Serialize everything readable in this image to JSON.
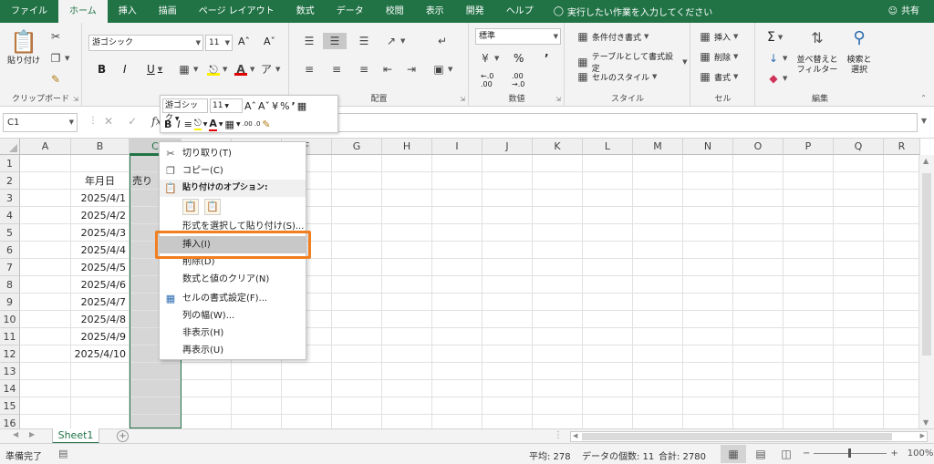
{
  "menubar": {
    "tabs": [
      "ファイル",
      "ホーム",
      "挿入",
      "描画",
      "ページ レイアウト",
      "数式",
      "データ",
      "校閲",
      "表示",
      "開発",
      "ヘルプ"
    ],
    "active_tab": "ホーム",
    "tellme": "実行したい作業を入力してください",
    "share": "共有"
  },
  "ribbon": {
    "clipboard": {
      "label": "クリップボード",
      "paste": "貼り付け"
    },
    "font": {
      "label": "フォント",
      "name": "游ゴシック",
      "size": "11"
    },
    "alignment": {
      "label": "配置"
    },
    "number": {
      "label": "数値",
      "format": "標準"
    },
    "styles": {
      "label": "スタイル",
      "conditional": "条件付き書式",
      "table": "テーブルとして書式設定",
      "cellstyle": "セルのスタイル"
    },
    "cells": {
      "label": "セル",
      "insert": "挿入",
      "delete": "削除",
      "format": "書式"
    },
    "editing": {
      "label": "編集",
      "sort": "並べ替えと",
      "sort2": "フィルター",
      "find": "検索と",
      "find2": "選択"
    }
  },
  "formula_bar": {
    "name_box": "C1",
    "value": ""
  },
  "grid": {
    "columns": [
      "A",
      "B",
      "C",
      "D",
      "E",
      "F",
      "G",
      "H",
      "I",
      "J",
      "K",
      "L",
      "M",
      "N",
      "O",
      "P",
      "Q",
      "R"
    ],
    "selected_column": "C",
    "rows": [
      "1",
      "2",
      "3",
      "4",
      "5",
      "6",
      "7",
      "8",
      "9",
      "10",
      "11",
      "12",
      "13",
      "14",
      "15",
      "16"
    ],
    "b_values": [
      "",
      "年月日",
      "2025/4/1",
      "2025/4/2",
      "2025/4/3",
      "2025/4/4",
      "2025/4/5",
      "2025/4/6",
      "2025/4/7",
      "2025/4/8",
      "2025/4/9",
      "2025/4/10",
      "",
      "",
      "",
      ""
    ],
    "c2": "売り"
  },
  "mini_toolbar": {
    "font": "游ゴシック",
    "size": "11"
  },
  "context_menu": {
    "items": [
      {
        "label": "切り取り(T)",
        "icon": "scissors-icon"
      },
      {
        "label": "コピー(C)",
        "icon": "copy-icon"
      },
      {
        "label": "貼り付けのオプション:",
        "icon": "paste-icon"
      },
      {
        "label": "形式を選択して貼り付け(S)...",
        "icon": ""
      },
      {
        "label": "挿入(I)",
        "icon": ""
      },
      {
        "label": "削除(D)",
        "icon": ""
      },
      {
        "label": "数式と値のクリア(N)",
        "icon": ""
      },
      {
        "label": "セルの書式設定(F)...",
        "icon": "format-cells-icon"
      },
      {
        "label": "列の幅(W)...",
        "icon": ""
      },
      {
        "label": "非表示(H)",
        "icon": ""
      },
      {
        "label": "再表示(U)",
        "icon": ""
      }
    ],
    "highlighted": "挿入(I)",
    "highlight_color": "#f07f20"
  },
  "sheet_tabs": {
    "active": "Sheet1"
  },
  "status_bar": {
    "ready": "準備完了",
    "average": "平均: 278",
    "count": "データの個数: 11",
    "sum": "合計: 2780",
    "zoom": "100%"
  },
  "colors": {
    "brand": "#217346",
    "callout": "#f07f20"
  }
}
